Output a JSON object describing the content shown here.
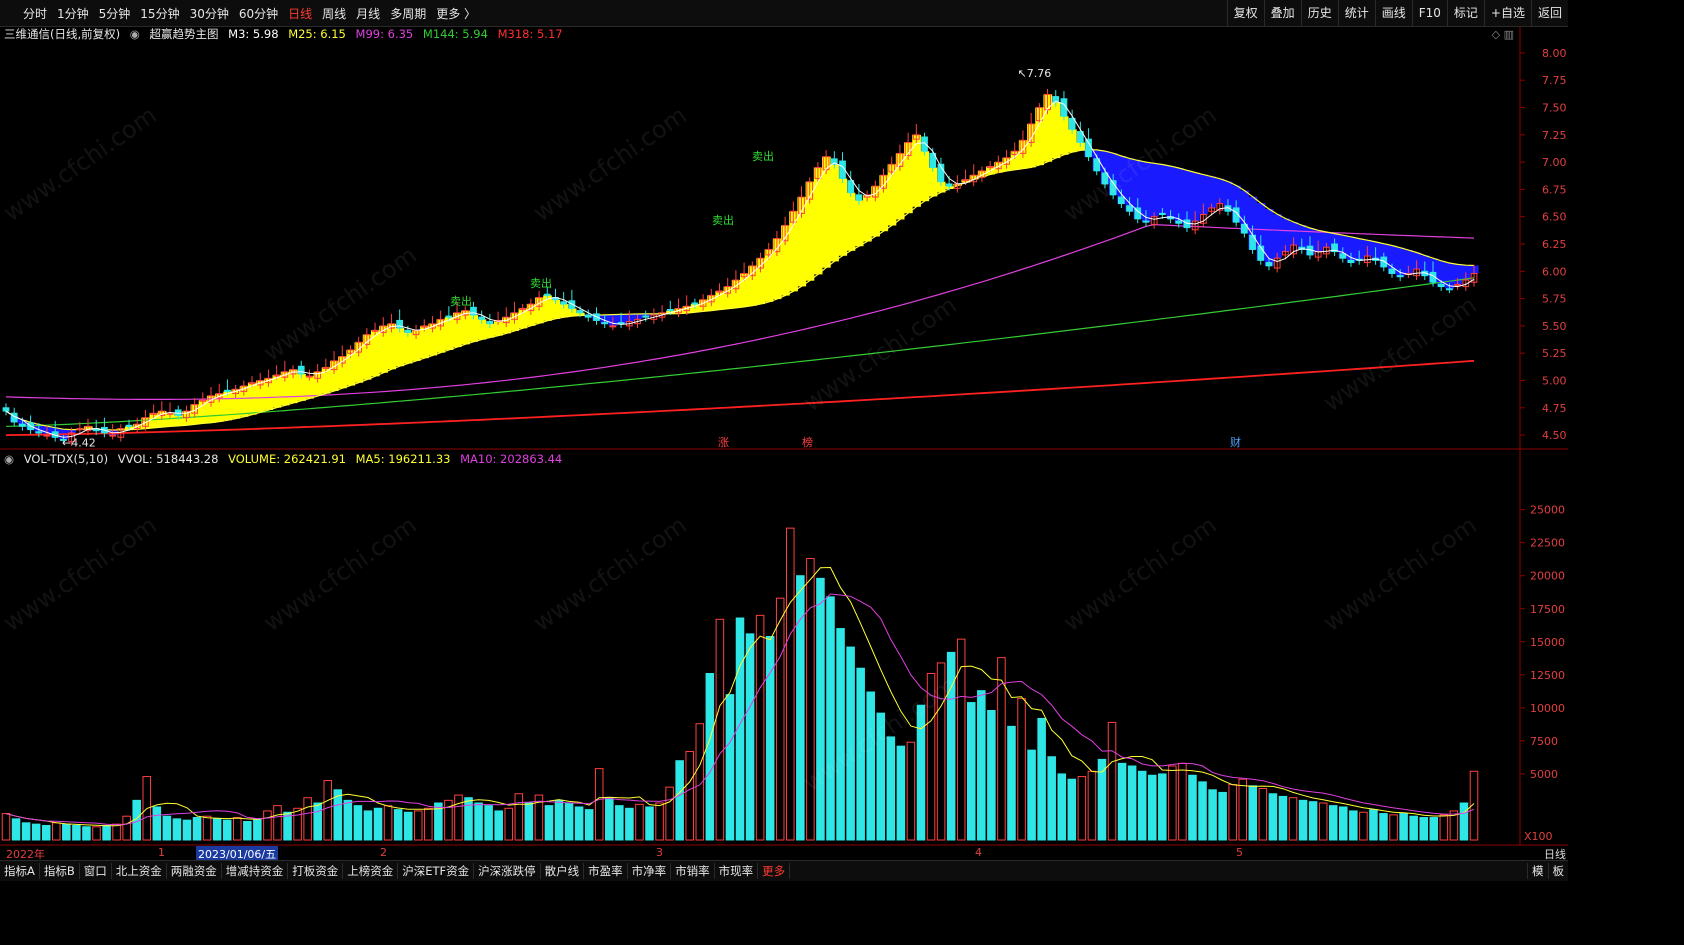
{
  "topbar": {
    "periods": [
      "分时",
      "1分钟",
      "5分钟",
      "15分钟",
      "30分钟",
      "60分钟",
      "日线",
      "周线",
      "月线",
      "多周期",
      "更多 〉"
    ],
    "active": "日线",
    "right_tools": [
      "复权",
      "叠加",
      "历史",
      "统计",
      "画线",
      "F10",
      "标记",
      "+自选",
      "返回"
    ]
  },
  "main_legend": {
    "stock": "三维通信(日线,前复权)",
    "indicator": "超赢趋势主图",
    "ma3": "M3: 5.98",
    "ma25": "M25: 6.15",
    "ma99": "M99: 6.35",
    "ma144": "M144: 5.94",
    "ma318": "M318: 5.17"
  },
  "vol_legend": {
    "name": "VOL-TDX(5,10)",
    "vvol": "VVOL: 518443.28",
    "volume": "VOLUME: 262421.91",
    "ma5": "MA5: 196211.33",
    "ma10": "MA10: 202863.44"
  },
  "colors": {
    "up": "#ff4040",
    "down": "#2ee6e6",
    "m3": "#ffffff",
    "m25": "#ffff33",
    "m99": "#e040e0",
    "m144": "#33cc33",
    "m318": "#ff2020",
    "yellow_band": "#ffff00",
    "blue_band": "#1a1aff"
  },
  "annotations": {
    "high": "7.76",
    "low": "4.42",
    "sell": "卖出",
    "markers": [
      "涨",
      "榜",
      "财"
    ]
  },
  "dates": {
    "year": "2022年",
    "m1": "1",
    "selected": "2023/01/06/五",
    "m2": "2",
    "m3": "3",
    "m4": "4",
    "m5": "5"
  },
  "x100": "X100",
  "day_label": "日线",
  "bottombar": {
    "tabs": [
      "指标A",
      "指标B",
      "窗口",
      "北上资金",
      "两融资金",
      "增减持资金",
      "打板资金",
      "上榜资金",
      "沪深ETF资金",
      "沪深涨跌停",
      "散户线",
      "市盈率",
      "市净率",
      "市销率",
      "市现率",
      "更多"
    ],
    "active": "更多",
    "right": [
      "模",
      "板"
    ]
  },
  "chart_data": [
    {
      "type": "candlestick",
      "title": "三维通信(日线,前复权)",
      "ylim": [
        4.4,
        8.1
      ],
      "yticks": [
        "8.00",
        "7.75",
        "7.50",
        "7.25",
        "7.00",
        "6.75",
        "6.50",
        "6.25",
        "6.00",
        "5.75",
        "5.50",
        "5.25",
        "5.00",
        "4.75",
        "4.50"
      ],
      "close": [
        4.72,
        4.62,
        4.58,
        4.55,
        4.52,
        4.5,
        4.48,
        4.46,
        4.52,
        4.56,
        4.58,
        4.54,
        4.52,
        4.5,
        4.56,
        4.58,
        4.6,
        4.66,
        4.7,
        4.72,
        4.7,
        4.68,
        4.72,
        4.78,
        4.82,
        4.86,
        4.88,
        4.9,
        4.92,
        4.95,
        4.98,
        5.0,
        5.02,
        5.05,
        5.08,
        5.1,
        5.06,
        5.04,
        5.08,
        5.12,
        5.18,
        5.22,
        5.28,
        5.35,
        5.42,
        5.46,
        5.5,
        5.52,
        5.48,
        5.44,
        5.46,
        5.5,
        5.52,
        5.56,
        5.58,
        5.62,
        5.64,
        5.6,
        5.56,
        5.52,
        5.55,
        5.58,
        5.62,
        5.66,
        5.7,
        5.76,
        5.78,
        5.74,
        5.7,
        5.66,
        5.62,
        5.58,
        5.55,
        5.52,
        5.5,
        5.52,
        5.54,
        5.56,
        5.58,
        5.6,
        5.62,
        5.64,
        5.66,
        5.68,
        5.7,
        5.74,
        5.78,
        5.82,
        5.86,
        5.92,
        5.98,
        6.05,
        6.12,
        6.2,
        6.3,
        6.42,
        6.55,
        6.68,
        6.82,
        6.95,
        7.05,
        6.98,
        6.85,
        6.72,
        6.65,
        6.7,
        6.78,
        6.88,
        6.98,
        7.08,
        7.18,
        7.25,
        7.1,
        6.95,
        6.82,
        6.78,
        6.8,
        6.84,
        6.88,
        6.92,
        6.96,
        7.0,
        7.04,
        7.1,
        7.2,
        7.35,
        7.5,
        7.62,
        7.55,
        7.42,
        7.3,
        7.18,
        7.05,
        6.92,
        6.8,
        6.7,
        6.62,
        6.55,
        6.48,
        6.45,
        6.5,
        6.52,
        6.48,
        6.44,
        6.4,
        6.46,
        6.52,
        6.58,
        6.62,
        6.55,
        6.45,
        6.35,
        6.2,
        6.1,
        6.05,
        6.12,
        6.18,
        6.24,
        6.2,
        6.15,
        6.18,
        6.22,
        6.18,
        6.12,
        6.08,
        6.1,
        6.14,
        6.1,
        6.04,
        5.98,
        5.95,
        5.98,
        6.02,
        5.96,
        5.9,
        5.86,
        5.84,
        5.88,
        5.92,
        5.98
      ]
    },
    {
      "type": "bar",
      "title": "VOL-TDX(5,10)",
      "ylim": [
        0,
        28000
      ],
      "yticks": [
        "25000",
        "22500",
        "20000",
        "17500",
        "15000",
        "12500",
        "10000",
        "7500",
        "5000"
      ],
      "values": [
        2000,
        1600,
        1300,
        1200,
        1100,
        1300,
        1200,
        1100,
        1000,
        1000,
        1100,
        1200,
        1800,
        3000,
        4800,
        2500,
        1800,
        1600,
        1500,
        1700,
        1800,
        1600,
        1500,
        1700,
        1400,
        1600,
        2200,
        2600,
        2100,
        2400,
        3200,
        2800,
        4500,
        3800,
        3000,
        2600,
        2200,
        2400,
        2600,
        2300,
        2100,
        2200,
        2400,
        2800,
        3000,
        3400,
        3200,
        2800,
        2600,
        2200,
        2400,
        3500,
        2800,
        3400,
        2600,
        3000,
        2800,
        2500,
        2300,
        5400,
        3200,
        2600,
        2400,
        2700,
        2500,
        2800,
        4000,
        6000,
        6700,
        8800,
        12600,
        16700,
        11000,
        16800,
        15600,
        17000,
        15400,
        18300,
        23600,
        20000,
        21300,
        19800,
        18400,
        16000,
        14600,
        13000,
        11200,
        9600,
        7800,
        7100,
        7400,
        10200,
        12600,
        13400,
        14200,
        15200,
        10400,
        11300,
        9800,
        13800,
        8600,
        10700,
        6800,
        9200,
        6300,
        5000,
        4600,
        4800,
        5200,
        6100,
        8900,
        5800,
        5600,
        5200,
        4900,
        5000,
        5600,
        5800,
        4900,
        4400,
        3800,
        3600,
        4200,
        4600,
        4100,
        3900,
        3500,
        3300,
        3200,
        3000,
        2900,
        2800,
        2600,
        2500,
        2200,
        2100,
        2300,
        2000,
        1900,
        2000,
        1800,
        1700,
        1700,
        1900,
        2200,
        2800,
        5200
      ]
    }
  ]
}
